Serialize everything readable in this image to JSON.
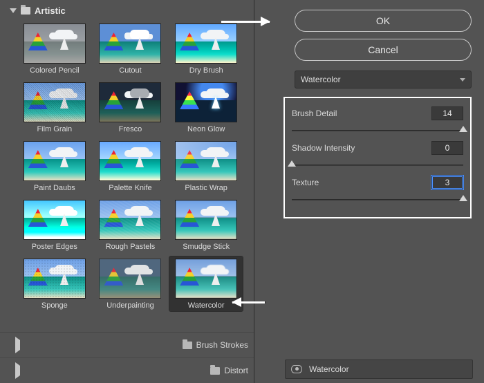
{
  "categories": {
    "open": "Artistic",
    "collapsed": [
      "Brush Strokes",
      "Distort"
    ]
  },
  "filters": [
    {
      "id": "colored-pencil",
      "label": "Colored Pencil",
      "variant": "v-pencil"
    },
    {
      "id": "cutout",
      "label": "Cutout",
      "variant": "v-cutout"
    },
    {
      "id": "dry-brush",
      "label": "Dry Brush",
      "variant": "v-drybrush"
    },
    {
      "id": "film-grain",
      "label": "Film Grain",
      "variant": "v-filmgrain"
    },
    {
      "id": "fresco",
      "label": "Fresco",
      "variant": "v-fresco"
    },
    {
      "id": "neon-glow",
      "label": "Neon Glow",
      "variant": "v-neon"
    },
    {
      "id": "paint-daubs",
      "label": "Paint Daubs",
      "variant": "v-paint"
    },
    {
      "id": "palette-knife",
      "label": "Palette Knife",
      "variant": "v-palette"
    },
    {
      "id": "plastic-wrap",
      "label": "Plastic Wrap",
      "variant": "v-plastic"
    },
    {
      "id": "poster-edges",
      "label": "Poster Edges",
      "variant": "v-poster"
    },
    {
      "id": "rough-pastels",
      "label": "Rough Pastels",
      "variant": "v-rough"
    },
    {
      "id": "smudge-stick",
      "label": "Smudge Stick",
      "variant": "v-smudge"
    },
    {
      "id": "sponge",
      "label": "Sponge",
      "variant": "v-sponge"
    },
    {
      "id": "underpainting",
      "label": "Underpainting",
      "variant": "v-under"
    },
    {
      "id": "watercolor",
      "label": "Watercolor",
      "variant": "v-water"
    }
  ],
  "selected_filter": "watercolor",
  "buttons": {
    "ok": "OK",
    "cancel": "Cancel"
  },
  "dropdown": {
    "value": "Watercolor"
  },
  "params": {
    "brush_detail": {
      "label": "Brush Detail",
      "value": "14",
      "min": 1,
      "max": 14
    },
    "shadow_intensity": {
      "label": "Shadow Intensity",
      "value": "0",
      "min": 0,
      "max": 10
    },
    "texture": {
      "label": "Texture",
      "value": "3",
      "min": 1,
      "max": 3
    }
  },
  "layer": {
    "name": "Watercolor"
  }
}
